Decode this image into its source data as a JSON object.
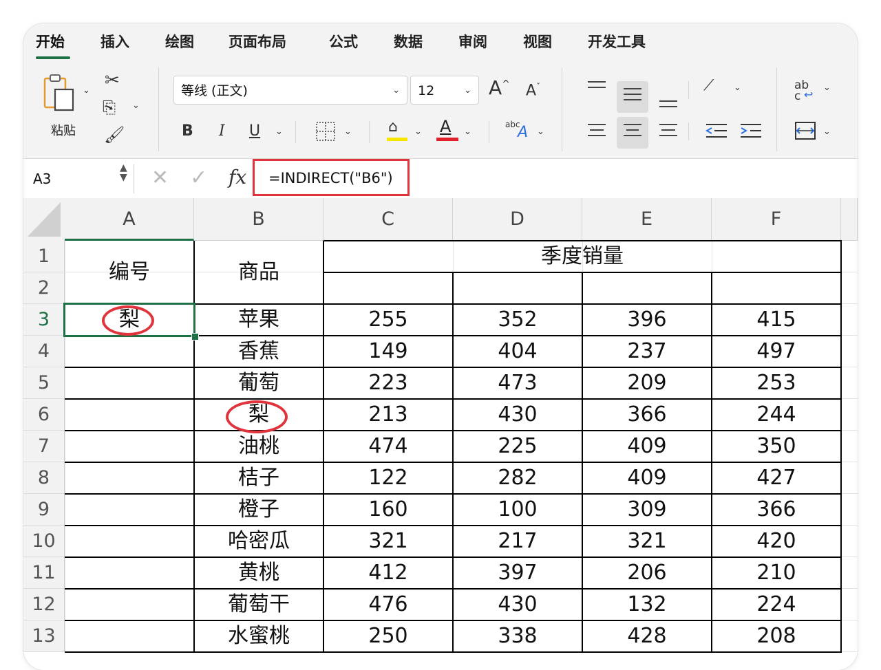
{
  "tabs": [
    "开始",
    "插入",
    "绘图",
    "页面布局",
    "公式",
    "数据",
    "审阅",
    "视图",
    "开发工具"
  ],
  "ribbon": {
    "paste_label": "粘贴",
    "font_name": "等线 (正文)",
    "font_size": "12",
    "bold": "B",
    "italic": "I",
    "underline": "U",
    "grow": "A",
    "shrink": "A",
    "font_color_glyph": "A",
    "abc": "abc",
    "abc_a": "A",
    "wrap_top": "ab",
    "wrap_bottom": "c",
    "fill_color": "#f7e600",
    "font_color": "#e0202a"
  },
  "formula_bar": {
    "name_box": "A3",
    "fx": "fx",
    "formula": "=INDIRECT(\"B6\")"
  },
  "columns": [
    "A",
    "B",
    "C",
    "D",
    "E",
    "F"
  ],
  "row_numbers": [
    "1",
    "2",
    "3",
    "4",
    "5",
    "6",
    "7",
    "8",
    "9",
    "10",
    "11",
    "12",
    "13"
  ],
  "header": {
    "id": "编号",
    "product": "商品",
    "quarter_sales": "季度销量"
  },
  "a3_value": "梨",
  "rows": [
    {
      "product": "苹果",
      "c": "255",
      "d": "352",
      "e": "396",
      "f": "415"
    },
    {
      "product": "香蕉",
      "c": "149",
      "d": "404",
      "e": "237",
      "f": "497"
    },
    {
      "product": "葡萄",
      "c": "223",
      "d": "473",
      "e": "209",
      "f": "253"
    },
    {
      "product": "梨",
      "c": "213",
      "d": "430",
      "e": "366",
      "f": "244"
    },
    {
      "product": "油桃",
      "c": "474",
      "d": "225",
      "e": "409",
      "f": "350"
    },
    {
      "product": "桔子",
      "c": "122",
      "d": "282",
      "e": "409",
      "f": "427"
    },
    {
      "product": "橙子",
      "c": "160",
      "d": "100",
      "e": "309",
      "f": "366"
    },
    {
      "product": "哈密瓜",
      "c": "321",
      "d": "217",
      "e": "321",
      "f": "420"
    },
    {
      "product": "黄桃",
      "c": "412",
      "d": "397",
      "e": "206",
      "f": "210"
    },
    {
      "product": "葡萄干",
      "c": "476",
      "d": "430",
      "e": "132",
      "f": "224"
    },
    {
      "product": "水蜜桃",
      "c": "250",
      "d": "338",
      "e": "428",
      "f": "208"
    }
  ],
  "accent": "#1e7145",
  "highlight": "#e0343c"
}
